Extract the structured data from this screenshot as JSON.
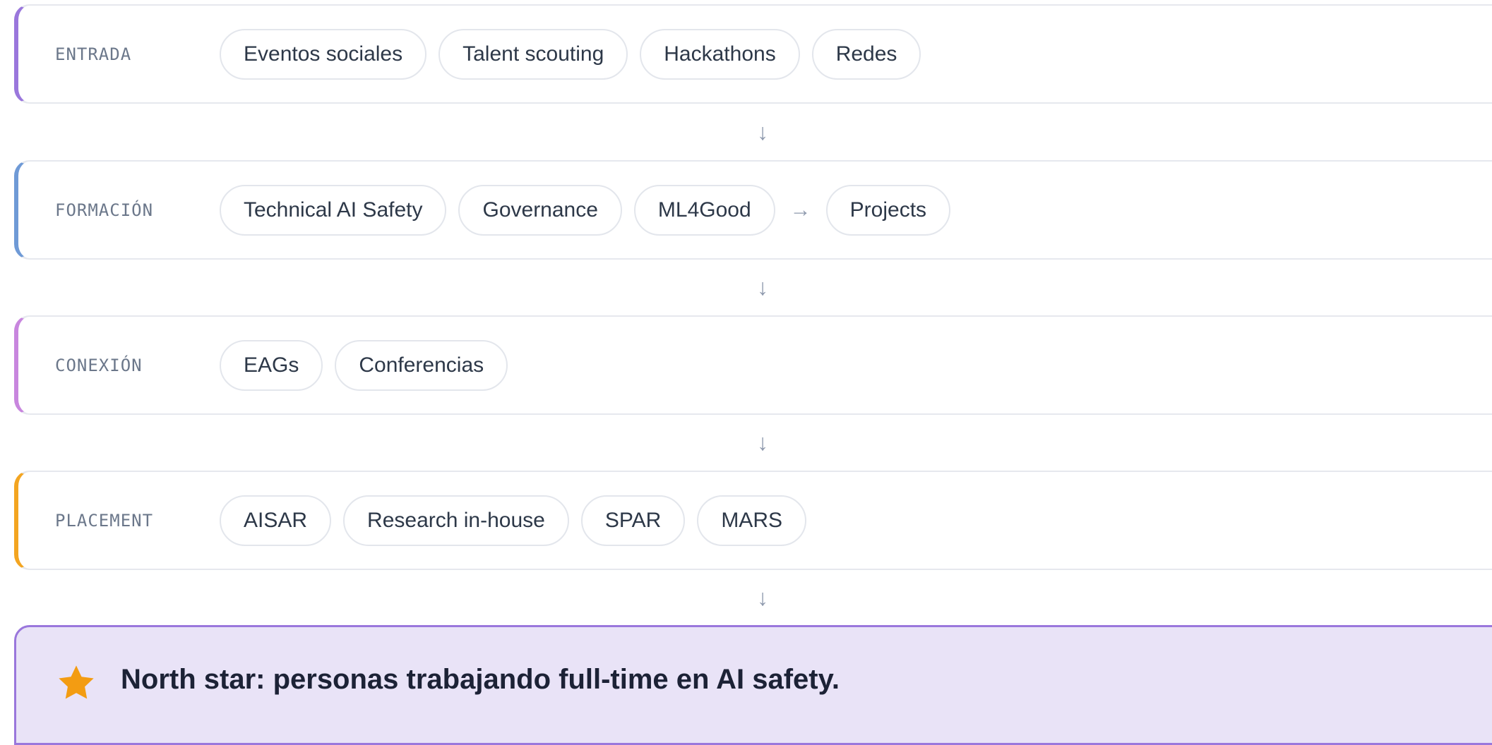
{
  "colors": {
    "entrada": "#9a77dc",
    "formacion": "#6f9ad6",
    "conexion": "#c886de",
    "placement": "#f3a521",
    "star": "#f39c12",
    "north_bg": "#e9e3f7"
  },
  "stages": [
    {
      "label": "ENTRADA",
      "chips": [
        "Eventos sociales",
        "Talent scouting",
        "Hackathons",
        "Redes"
      ]
    },
    {
      "label": "FORMACIÓN",
      "chips": [
        "Technical AI Safety",
        "Governance",
        "ML4Good",
        "Projects"
      ],
      "inner_arrow": "→"
    },
    {
      "label": "CONEXIÓN",
      "chips": [
        "EAGs",
        "Conferencias"
      ]
    },
    {
      "label": "PLACEMENT",
      "chips": [
        "AISAR",
        "Research in-house",
        "SPAR",
        "MARS"
      ]
    }
  ],
  "flow_arrow": "↓",
  "north_star": {
    "icon": "star-icon",
    "text": "North star: personas trabajando full-time en AI safety."
  }
}
